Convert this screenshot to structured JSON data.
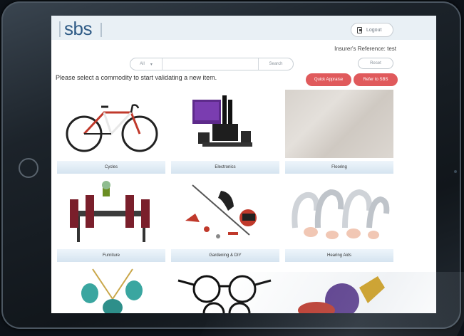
{
  "header": {
    "logo_text": "sbs",
    "logout_label": "Logout"
  },
  "insurer_reference": "Insurer's Reference: test",
  "search": {
    "filter_value": "All",
    "placeholder": "",
    "search_label": "Search",
    "reset_label": "Reset"
  },
  "instruction": "Please select a commodity to start validating a new item.",
  "actions": {
    "quick_label": "Quick Appraise",
    "refer_label": "Refer to SBS"
  },
  "commodities": [
    {
      "label": "Cycles"
    },
    {
      "label": "Electronics"
    },
    {
      "label": "Flooring"
    },
    {
      "label": "Furniture"
    },
    {
      "label": "Gardening & DIY"
    },
    {
      "label": "Hearing Aids"
    },
    {
      "label": ""
    },
    {
      "label": ""
    },
    {
      "label": ""
    }
  ],
  "colors": {
    "brand": "#2f5b86",
    "accent_button": "#e05a5c",
    "header_bg": "#e9f0f5"
  }
}
